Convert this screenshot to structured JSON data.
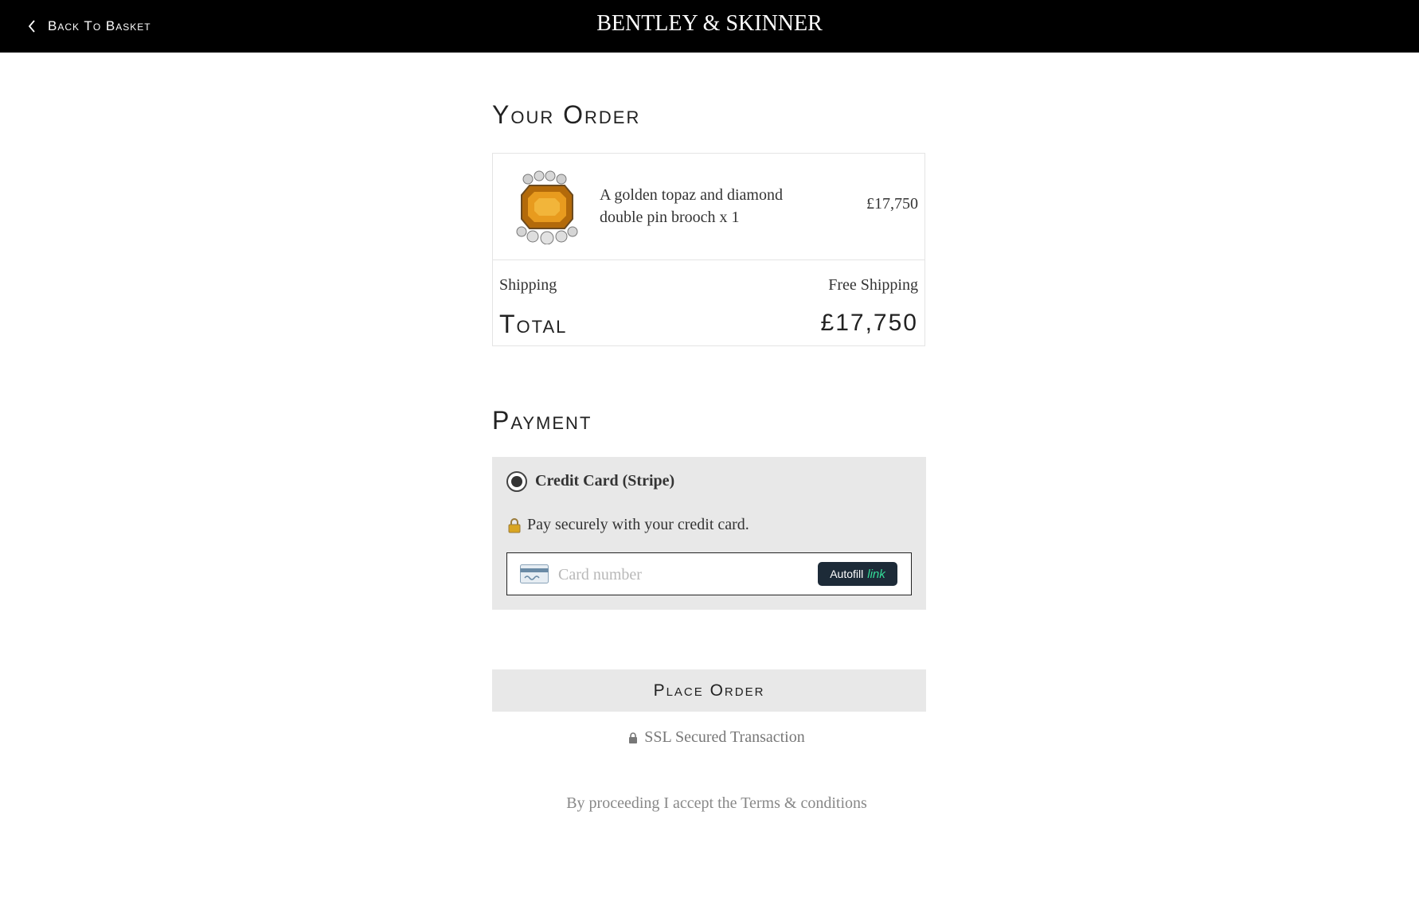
{
  "header": {
    "back_label": "Back To Basket",
    "brand": "BENTLEY & SKINNER"
  },
  "order": {
    "heading": "Your Order",
    "item": {
      "name": "A golden topaz and diamond double pin brooch x 1",
      "price": "£17,750"
    },
    "shipping_label": "Shipping",
    "shipping_value": "Free Shipping",
    "total_label": "Total",
    "total_value": "£17,750"
  },
  "payment": {
    "heading": "Payment",
    "method_label": "Credit Card (Stripe)",
    "method_selected": true,
    "secure_note": "Pay securely with your credit card.",
    "card_placeholder": "Card number",
    "autofill_label": "Autofill",
    "autofill_brand": "link"
  },
  "actions": {
    "place_order": "Place Order",
    "ssl_note": "SSL Secured Transaction",
    "terms_prefix": "By proceeding I accept the",
    "terms_link": "Terms & conditions"
  },
  "colors": {
    "topbar": "#000000",
    "panel": "#e8e8e8",
    "link_green": "#33dd99",
    "autofill_bg": "#1d2b38"
  }
}
